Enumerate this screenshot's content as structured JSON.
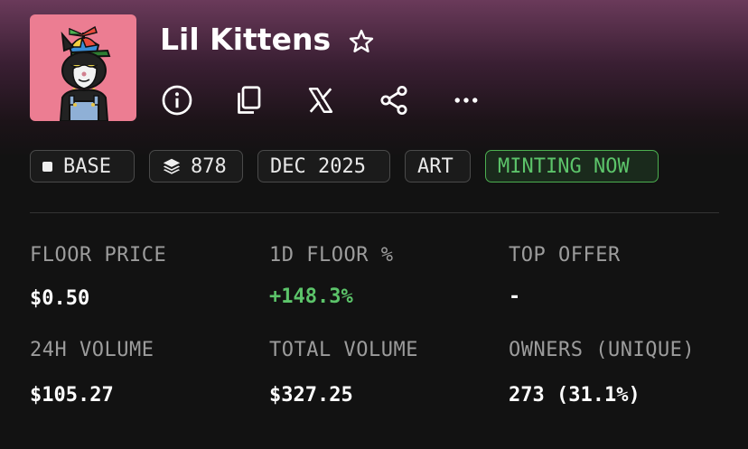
{
  "collection": {
    "name": "Lil Kittens",
    "avatar_alt": "cat-with-propeller-cap"
  },
  "actions": [
    {
      "name": "info-icon"
    },
    {
      "name": "copy-icon"
    },
    {
      "name": "x-icon"
    },
    {
      "name": "share-icon"
    },
    {
      "name": "more-icon"
    }
  ],
  "tags": {
    "chain": "BASE",
    "supply": "878",
    "date": "DEC 2025",
    "category": "ART",
    "status": "MINTING NOW"
  },
  "stats": {
    "floor_price": {
      "label": "FLOOR PRICE",
      "value": "$0.50"
    },
    "floor_change": {
      "label": "1D FLOOR %",
      "value": "+148.3%"
    },
    "top_offer": {
      "label": "TOP OFFER",
      "value": "-"
    },
    "volume_24h": {
      "label": "24H VOLUME",
      "value": "$105.27"
    },
    "total_volume": {
      "label": "TOTAL VOLUME",
      "value": "$327.25"
    },
    "owners": {
      "label": "OWNERS (UNIQUE)",
      "value": "273 (31.1%)"
    }
  },
  "colors": {
    "positive": "#5cc46a",
    "minting_border": "#4caf50",
    "avatar_bg": "#ec7d92"
  }
}
